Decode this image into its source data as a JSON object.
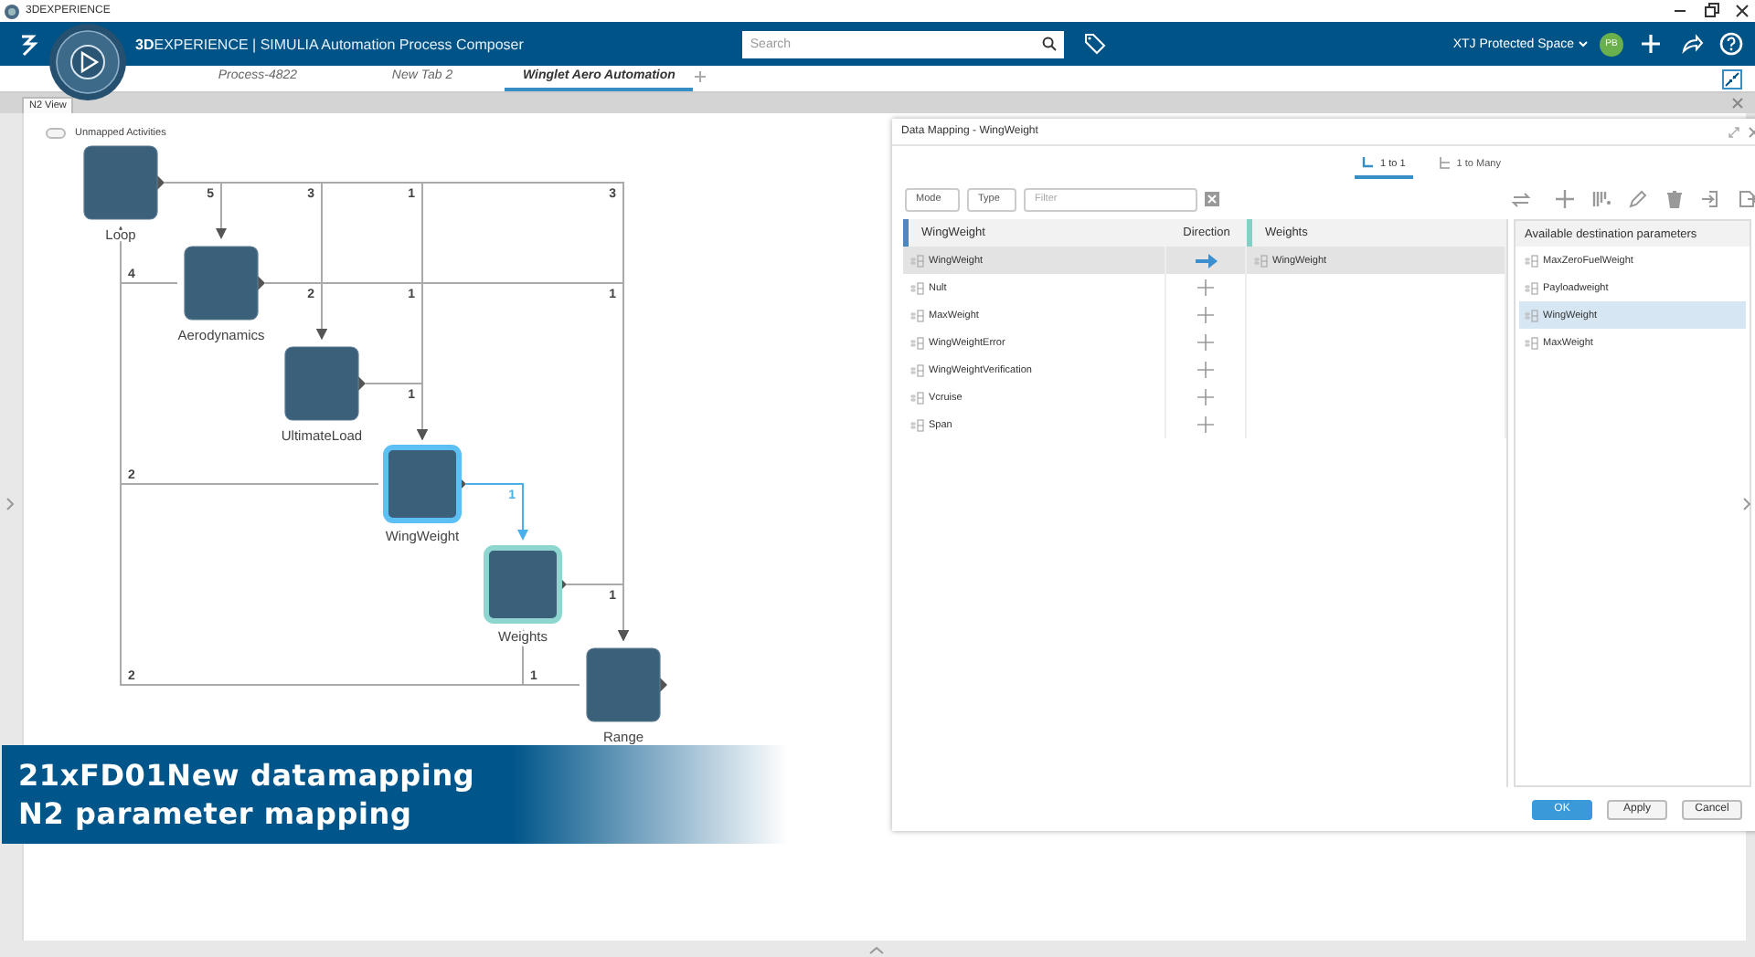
{
  "window": {
    "title": "3DEXPERIENCE"
  },
  "top_bar": {
    "app_title": "**3D**EXPERIENCE | SIMULIA Automation Process Composer",
    "search": {
      "placeholder": "Search"
    },
    "space": "XTJ Protected Space",
    "avatar": "PB"
  },
  "tabs": [
    {
      "label": "Process-4822",
      "selected": false
    },
    {
      "label": "New Tab 2",
      "selected": false
    },
    {
      "label": "Winglet Aero Automation",
      "selected": true
    }
  ],
  "view_tabs": [
    {
      "label": "N2 View",
      "selected": true
    }
  ],
  "toggle": {
    "label": "Unmapped Activities",
    "on": false
  },
  "diagram": {
    "nodes": [
      {
        "label": "Loop",
        "selected": false,
        "mapped": false,
        "outputs": [
          {
            "kind": "empty"
          },
          {
            "kind": "link",
            "count": "5",
            "selected": false
          },
          {
            "kind": "link",
            "count": "3",
            "selected": false
          },
          {
            "kind": "link",
            "count": "1",
            "selected": false
          },
          {
            "kind": "empty"
          },
          {
            "kind": "link",
            "count": "3",
            "selected": false
          }
        ]
      },
      {
        "label": "Aerodynamics",
        "selected": false,
        "mapped": false,
        "outputs": [
          {
            "kind": "link",
            "count": "4",
            "selected": false
          },
          {
            "kind": "empty"
          },
          {
            "kind": "link",
            "count": "2",
            "selected": false
          },
          {
            "kind": "link",
            "count": "1",
            "selected": false
          },
          {
            "kind": "empty"
          },
          {
            "kind": "link",
            "count": "1",
            "selected": false
          }
        ]
      },
      {
        "label": "UltimateLoad",
        "selected": false,
        "mapped": false,
        "outputs": [
          {
            "kind": "empty"
          },
          {
            "kind": "empty"
          },
          {
            "kind": "empty"
          },
          {
            "kind": "link",
            "count": "1",
            "selected": false
          },
          {
            "kind": "empty"
          },
          {
            "kind": "empty"
          }
        ]
      },
      {
        "label": "WingWeight",
        "selected": true,
        "mapped": false,
        "outputs": [
          {
            "kind": "link",
            "count": "2",
            "selected": false
          },
          {
            "kind": "empty"
          },
          {
            "kind": "empty"
          },
          {
            "kind": "empty"
          },
          {
            "kind": "link",
            "count": "1",
            "selected": true
          },
          {
            "kind": "empty"
          }
        ]
      },
      {
        "label": "Weights",
        "selected": false,
        "mapped": true,
        "outputs": [
          {
            "kind": "empty"
          },
          {
            "kind": "empty"
          },
          {
            "kind": "empty"
          },
          {
            "kind": "empty"
          },
          {
            "kind": "empty"
          },
          {
            "kind": "link",
            "count": "1",
            "selected": false
          }
        ]
      },
      {
        "label": "Range",
        "selected": false,
        "mapped": false,
        "outputs": [
          {
            "kind": "link",
            "count": "2",
            "selected": false
          },
          {
            "kind": "empty"
          },
          {
            "kind": "empty"
          },
          {
            "kind": "empty"
          },
          {
            "kind": "link",
            "count": "1",
            "selected": false
          },
          {
            "kind": "empty"
          }
        ]
      }
    ]
  },
  "dialog": {
    "title": "Data Mapping - WingWeight",
    "tabs": [
      {
        "label": "1 to 1",
        "selected": true
      },
      {
        "label": "1 to Many",
        "selected": false
      }
    ],
    "mode": "Mode",
    "type": "Type",
    "filter": {
      "placeholder": "Filter"
    },
    "columns": [
      "WingWeight",
      "Direction",
      "Weights"
    ],
    "rows": [
      {
        "source": "WingWeight",
        "mapped": true,
        "target": "WingWeight",
        "selected": true
      },
      {
        "source": "Nult",
        "mapped": false,
        "selected": false
      },
      {
        "source": "MaxWeight",
        "mapped": false,
        "selected": false
      },
      {
        "source": "WingWeightError",
        "mapped": false,
        "selected": false
      },
      {
        "source": "WingWeightVerification",
        "mapped": false,
        "selected": false
      },
      {
        "source": "Vcruise",
        "mapped": false,
        "selected": false
      },
      {
        "source": "Span",
        "mapped": false,
        "selected": false
      }
    ],
    "destinations": {
      "title": "Available destination parameters",
      "items": [
        {
          "label": "MaxZeroFuelWeight",
          "selected": false
        },
        {
          "label": "Payloadweight",
          "selected": false
        },
        {
          "label": "WingWeight",
          "selected": true
        },
        {
          "label": "MaxWeight",
          "selected": false
        }
      ]
    },
    "buttons": [
      {
        "label": "OK",
        "kind": "primary"
      },
      {
        "label": "Apply",
        "kind": "secondary"
      },
      {
        "label": "Cancel",
        "kind": "secondary"
      }
    ]
  },
  "caption": {
    "lines": [
      "21xFD01New datamapping",
      "N2 parameter mapping"
    ]
  }
}
